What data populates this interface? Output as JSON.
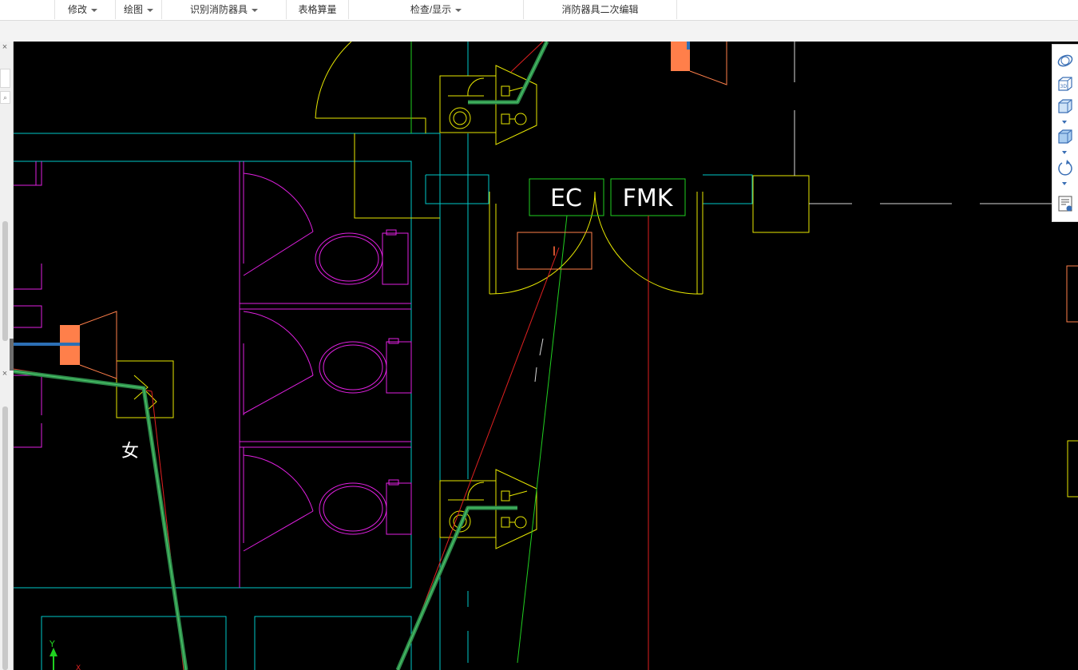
{
  "menu": {
    "modify": "修改",
    "draw": "绘图",
    "identify_fire_equipment": "识别消防器具",
    "table_quantity": "表格算量",
    "check_display": "检查/显示",
    "fire_equipment_edit": "消防器具二次编辑"
  },
  "drawing": {
    "door_label_ec": "EC",
    "door_label_fmk": "FMK",
    "room_label_female": "女",
    "tag_mark": "I",
    "axis_y": "Y",
    "axis_x": "X"
  },
  "toolbar_icons": [
    "orbit-icon",
    "3d-view-icon",
    "view-cube-icon",
    "view-cube-alt-icon",
    "rotate-icon",
    "properties-icon"
  ],
  "colors": {
    "canvas_bg": "#000000",
    "cyan_line": "#00c8c8",
    "magenta_line": "#e020e0",
    "yellow_line": "#e8e800",
    "green_line": "#20d020",
    "pipe_green": "#2e8b4a",
    "red_line": "#e02020",
    "orange_block": "#ff7f4a",
    "accent_blue": "#3a6fb5"
  }
}
